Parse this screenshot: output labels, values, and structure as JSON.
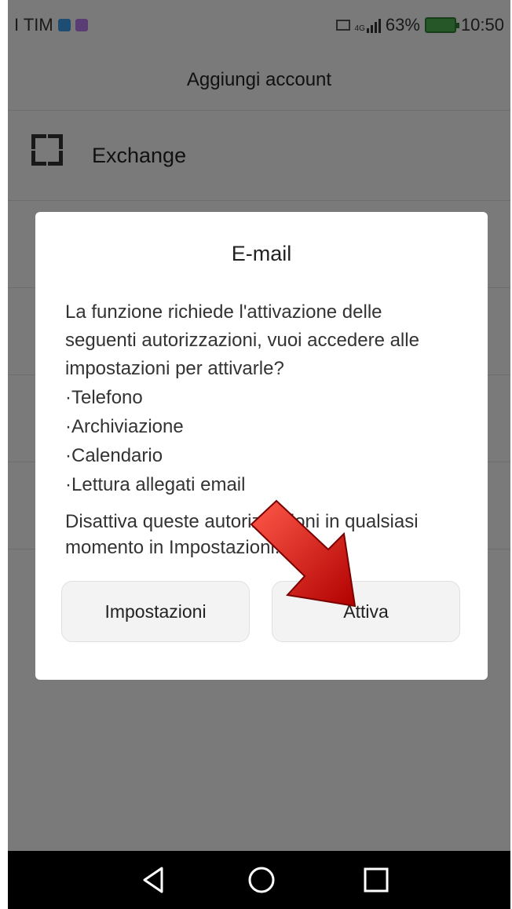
{
  "status_bar": {
    "carrier": "I TIM",
    "network": "4G",
    "battery": "63%",
    "time": "10:50"
  },
  "header": {
    "title": "Aggiungi account"
  },
  "accounts": [
    {
      "label": "Exchange",
      "icon": "exchange-icon"
    }
  ],
  "dialog": {
    "title": "E-mail",
    "message": "La funzione richiede l'attivazione delle seguenti autorizzazioni, vuoi accedere alle impostazioni per attivarle?",
    "permissions": [
      "·Telefono",
      "·Archiviazione",
      "·Calendario",
      "·Lettura allegati email"
    ],
    "note": "Disattiva queste autorizzazioni in qualsiasi momento in Impostazioni.",
    "buttons": {
      "settings": "Impostazioni",
      "enable": "Attiva"
    }
  },
  "navigation": {
    "back": "back-icon",
    "home": "home-icon",
    "recents": "recents-icon"
  },
  "colors": {
    "overlay": "#7f7f7f",
    "dialog": "#ffffff",
    "arrow": "#d50000",
    "nav_bar": "#000000"
  }
}
